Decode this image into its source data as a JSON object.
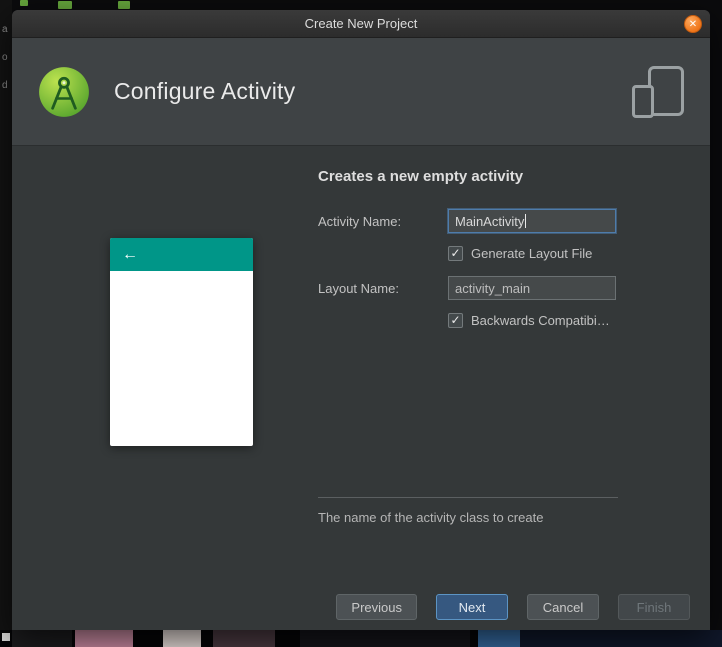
{
  "titlebar": {
    "title": "Create New Project",
    "close_glyph": "✕"
  },
  "header": {
    "title": "Configure Activity"
  },
  "preview": {
    "back_glyph": "←"
  },
  "form": {
    "heading": "Creates a new empty activity",
    "activity_name": {
      "label": "Activity Name:",
      "value": "MainActivity"
    },
    "generate_layout": {
      "label": "Generate Layout File",
      "checked": true,
      "check": "✓"
    },
    "layout_name": {
      "label": "Layout Name:",
      "value": "activity_main"
    },
    "backwards_compat": {
      "label": "Backwards Compatibi…",
      "checked": true,
      "check": "✓"
    },
    "help_text": "The name of the activity class to create"
  },
  "buttons": {
    "previous": "Previous",
    "next": "Next",
    "cancel": "Cancel",
    "finish": "Finish"
  },
  "colors": {
    "appbar_teal": "#009688",
    "close_orange": "#ef7519",
    "next_blue": "#365880"
  },
  "background": {
    "fragments": [
      "a",
      "o",
      "d"
    ]
  }
}
